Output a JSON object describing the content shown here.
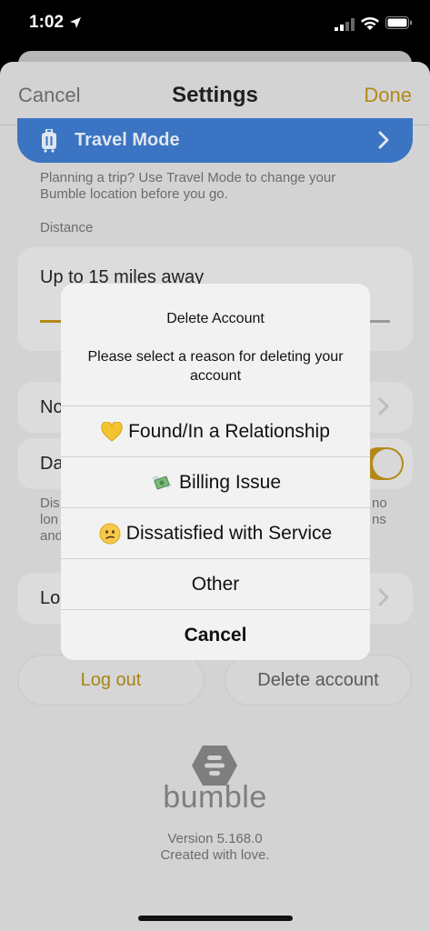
{
  "status_bar": {
    "time": "1:02"
  },
  "nav": {
    "cancel": "Cancel",
    "title": "Settings",
    "done": "Done"
  },
  "travel_mode": {
    "label": "Travel Mode",
    "helper": "Planning a trip? Use Travel Mode to change your Bumble location before you go."
  },
  "distance": {
    "section_label": "Distance",
    "value": "Up to 15 miles away",
    "fill_fraction": 0.07
  },
  "rows": {
    "row1_partial": "No",
    "row2_partial": "Da",
    "row2_desc_left": [
      "Dis",
      "lon",
      "and"
    ],
    "row2_desc_right": [
      "no",
      "ns"
    ],
    "row3_partial": "Lo"
  },
  "buttons": {
    "logout": "Log out",
    "delete_account": "Delete account"
  },
  "branding": {
    "logo": "bumble",
    "version": "Version 5.168.0",
    "tagline": "Created with love."
  },
  "alert": {
    "title": "Delete Account",
    "message": "Please select a reason for deleting your account",
    "actions": [
      {
        "label": "Found/In a Relationship",
        "icon": "yellow-heart-icon"
      },
      {
        "label": "Billing Issue",
        "icon": "money-with-wings-icon"
      },
      {
        "label": "Dissatisfied with Service",
        "icon": "confused-face-icon"
      },
      {
        "label": "Other",
        "icon": ""
      }
    ],
    "cancel": "Cancel"
  },
  "colors": {
    "accent": "#b38a1a",
    "travel_blue": "#3a74c2"
  }
}
